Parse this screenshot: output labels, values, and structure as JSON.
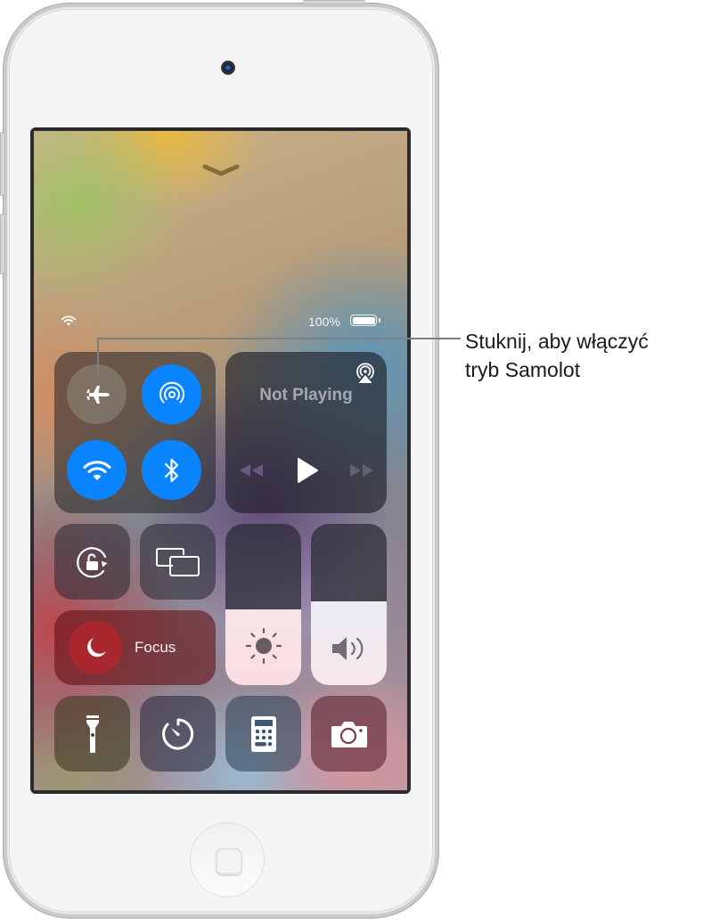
{
  "status_bar": {
    "wifi_icon": "wifi-icon",
    "battery_percent": "100%",
    "battery_level": 1.0
  },
  "control_center": {
    "dismiss_icon": "chevron-down-icon",
    "connectivity": [
      {
        "name": "airplane-mode",
        "icon": "airplane-icon",
        "state": "off"
      },
      {
        "name": "airdrop",
        "icon": "airdrop-icon",
        "state": "on"
      },
      {
        "name": "wifi",
        "icon": "wifi-icon",
        "state": "on"
      },
      {
        "name": "bluetooth",
        "icon": "bluetooth-icon",
        "state": "on"
      }
    ],
    "media": {
      "title": "Not Playing",
      "airplay_icon": "airplay-icon",
      "controls": [
        "rewind",
        "play",
        "fast-forward"
      ]
    },
    "orientation_lock_icon": "orientation-lock-icon",
    "screen_mirroring_icon": "screen-mirroring-icon",
    "focus": {
      "label": "Focus",
      "icon": "moon-icon"
    },
    "brightness": {
      "icon": "sun-icon",
      "level": 0.47
    },
    "volume": {
      "icon": "speaker-icon",
      "level": 0.52
    },
    "bottom_row": [
      {
        "name": "flashlight",
        "icon": "flashlight-icon"
      },
      {
        "name": "timer",
        "icon": "timer-icon"
      },
      {
        "name": "calculator",
        "icon": "calculator-icon"
      },
      {
        "name": "camera",
        "icon": "camera-icon"
      }
    ]
  },
  "callout": {
    "line1": "Stuknij, aby włączyć",
    "line2": "tryb Samolot"
  },
  "colors": {
    "accent_blue": "#0a84ff",
    "focus_red": "#a8282e"
  }
}
